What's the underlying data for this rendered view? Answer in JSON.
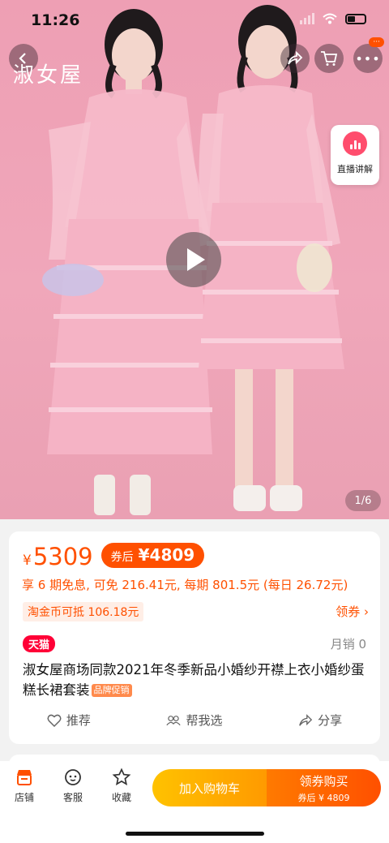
{
  "status_bar": {
    "time": "11:26"
  },
  "hero": {
    "brand_logo": "淑女屋",
    "live_label": "直播讲解",
    "image_counter": "1/6",
    "more_badge": "···"
  },
  "price": {
    "symbol": "¥",
    "current": "5309",
    "after_coupon_label": "券后",
    "after_coupon_value": "¥4809",
    "installment": "享 6 期免息, 可免 216.41元, 每期 801.5元 (每日 26.72元)",
    "coin_deduct": "淘金币可抵 106.18元",
    "coupon_link": "领券 ›"
  },
  "product": {
    "store_badge": "天猫",
    "monthly_sales": "月销 0",
    "title": "淑女屋商场同款2021年冬季新品小婚纱开襟上衣小婚纱蛋糕长裙套装",
    "promo_tag": "品牌促销"
  },
  "actions": {
    "recommend": "推荐",
    "help_choose": "帮我选",
    "share": "分享"
  },
  "bottom_bar": {
    "store": "店铺",
    "service": "客服",
    "favorite": "收藏",
    "add_to_cart": "加入购物车",
    "buy_now": "领券购买",
    "buy_now_sub": "券后 ¥ 4809"
  },
  "colors": {
    "accent": "#ff5000",
    "tmall": "#ff0036",
    "hero_bg": "#ee9fb4"
  }
}
